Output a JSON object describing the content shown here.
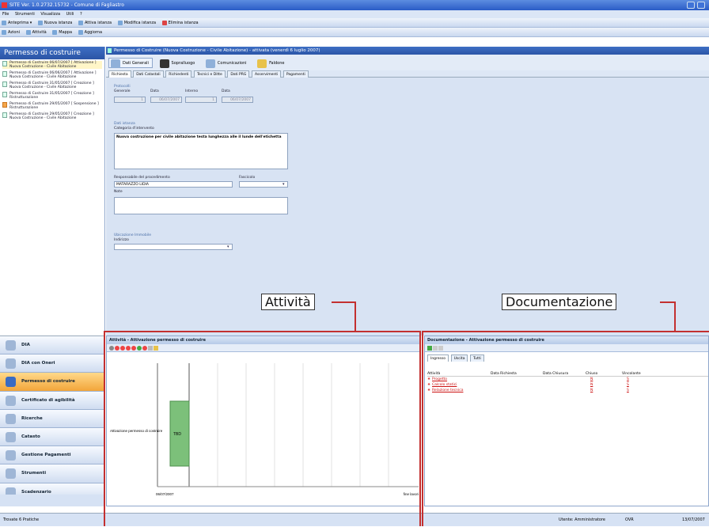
{
  "window": {
    "title": "SITE Ver. 1.0.2732.15732 - Comune di Fagliastro"
  },
  "menu": [
    "File",
    "Strumenti",
    "Visualizza",
    "Utili",
    "?"
  ],
  "toolbar1": [
    {
      "label": "Anteprima",
      "icon": "preview-icon"
    },
    {
      "label": "Nuova istanza",
      "icon": "new-icon"
    },
    {
      "label": "Attiva istanza",
      "icon": "activate-icon"
    },
    {
      "label": "Modifica istanza",
      "icon": "edit-icon"
    },
    {
      "label": "Elimina istanza",
      "icon": "delete-icon"
    }
  ],
  "toolbar2": [
    {
      "label": "Azioni",
      "icon": "actions-icon"
    },
    {
      "label": "Attività",
      "icon": "activity-icon"
    },
    {
      "label": "Mappa",
      "icon": "map-icon"
    },
    {
      "label": "Aggiorna",
      "icon": "refresh-icon"
    }
  ],
  "left": {
    "title": "Permesso di costruire",
    "tree": [
      {
        "text": "Permesso di Costruire 06/07/2007 [ Attivazione ] Nuova Costruzione - Civile Abitazione",
        "status": "ok"
      },
      {
        "text": "Permesso di Costruire 06/06/2007 [ Attivazione ] Nuova Costruzione - Civile Abitazione",
        "status": "ok"
      },
      {
        "text": "Permesso di Costruire 31/05/2007 [ Creazione ] Nuova Costruzione - Civile Abitazione",
        "status": "ok"
      },
      {
        "text": "Permesso di Costruire 31/05/2007 [ Creazione ] Ristrutturazione",
        "status": "ok"
      },
      {
        "text": "Permesso di Costruire 29/05/2007 [ Sospensione ] Ristrutturazione",
        "status": "warn"
      },
      {
        "text": "Permesso di Costruire 29/05/2007 [ Creazione ] Nuova Costruzione - Civile Abitazione",
        "status": "ok"
      }
    ],
    "nav": [
      {
        "label": "DIA",
        "icon": "dia-icon",
        "active": false
      },
      {
        "label": "DIA con Oneri",
        "icon": "dia-oneri-icon",
        "active": false
      },
      {
        "label": "Permesso di costruire",
        "icon": "building-permit-icon",
        "active": true
      },
      {
        "label": "Certificato di agibilità",
        "icon": "certificate-icon",
        "active": false
      },
      {
        "label": "Ricerche",
        "icon": "search-icon",
        "active": false
      },
      {
        "label": "Catasto",
        "icon": "cadastre-icon",
        "active": false
      },
      {
        "label": "Gestione Pagamenti",
        "icon": "payments-icon",
        "active": false
      },
      {
        "label": "Strumenti",
        "icon": "tools-icon",
        "active": false
      },
      {
        "label": "Scadenzario",
        "icon": "calendar-icon",
        "active": false
      }
    ],
    "footer": "Trovate 6 Pratiche"
  },
  "doc": {
    "title": "Permesso di Costruire (Nuova Costruzione - Civile Abitazione) - attivata (venerdì 6 luglio 2007)",
    "subtabs": [
      {
        "label": "Dati Generali",
        "icon": "general-data-icon",
        "active": true
      },
      {
        "label": "Sopralluogo",
        "icon": "inspection-icon",
        "active": false
      },
      {
        "label": "Comunicazioni",
        "icon": "communications-icon",
        "active": false
      },
      {
        "label": "Faldone",
        "icon": "binder-icon",
        "active": false
      }
    ],
    "tabs": [
      "Richiesta",
      "Dati Catastali",
      "Richiedenti",
      "Tecnici e Ditte",
      "Dati PRG",
      "Asservimenti",
      "Pagamenti"
    ],
    "protocolli": {
      "section": "Protocolli",
      "generale_label": "Generale",
      "data1_label": "Data",
      "interno_label": "Interno",
      "data2_label": "Data",
      "generale_val": "1",
      "data1_val": "06/07/2007",
      "interno_val": "1",
      "data2_val": "06/07/2007"
    },
    "istanza": {
      "section": "Dati istanza",
      "categoria_label": "Categoria d'intervento",
      "categoria_val": "Nuova costruzione per civile abitazione testa lunghezza alle il lunde dell'etichetta",
      "responsabile_label": "Responsabile del procedimento",
      "responsabile_val": "MATARAZZO LIDIA",
      "fascicolo_label": "Fascicolo",
      "note_label": "Note"
    },
    "ubicazione": {
      "section": "Ubicazione Immobile",
      "indirizzo_label": "Indirizzo"
    }
  },
  "attivita": {
    "header": "Attività - Attivazione permesso di costruire",
    "row_label": "Attivazione permesso di costruire",
    "bar_label": "TBD",
    "start_date": "06/07/2007",
    "end_label": "fine lavori"
  },
  "documentazione": {
    "header": "Documentazione - Attivazione permesso di costruire",
    "tabs": [
      "Ingresso",
      "Uscita",
      "Tutti"
    ],
    "columns": [
      "Attività",
      "Data Richiesta",
      "Data Chiusura",
      "Chiuso",
      "Vincolante"
    ],
    "rows": [
      {
        "name": "Progetto",
        "chiuso": "N",
        "vincolante": "S"
      },
      {
        "name": "Calcolo statici",
        "chiuso": "N",
        "vincolante": "S"
      },
      {
        "name": "Relazione tecnica",
        "chiuso": "N",
        "vincolante": "S"
      }
    ]
  },
  "callouts": {
    "attivita": "Attività",
    "documentazione": "Documentazione"
  },
  "status": {
    "user": "Utente: Amministratore",
    "ovr": "OVR",
    "date": "13/07/2007"
  },
  "colors": {
    "title_blue": "#2b55a6",
    "gantt_bar": "#7cc07a",
    "callout_line": "#c33030",
    "nav_active": "#f2a53a"
  }
}
